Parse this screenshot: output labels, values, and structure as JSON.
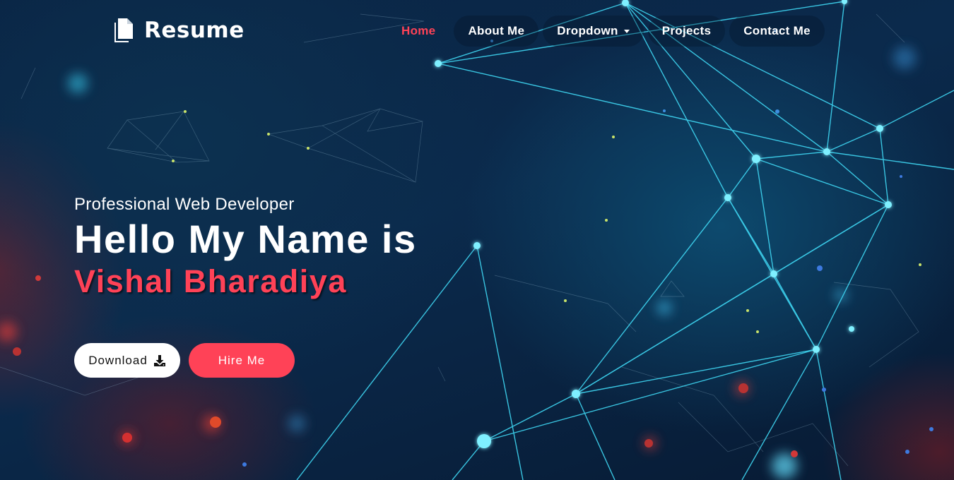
{
  "brand": {
    "name": "Resume",
    "icon": "copy-icon"
  },
  "nav": {
    "items": [
      {
        "label": "Home",
        "active": true
      },
      {
        "label": "About Me",
        "active": false
      },
      {
        "label": "Dropdown",
        "active": false,
        "has_caret": true
      },
      {
        "label": "Projects",
        "active": false
      },
      {
        "label": "Contact Me",
        "active": false
      }
    ]
  },
  "hero": {
    "subtitle": "Professional Web Developer",
    "title": "Hello My Name is",
    "name": "Vishal Bharadiya"
  },
  "actions": {
    "download_label": "Download",
    "download_icon": "download-icon",
    "hire_label": "Hire Me"
  },
  "colors": {
    "accent": "#ff4257",
    "text": "#ffffff",
    "background": "#0a2444",
    "network_line": "#3fd6f2"
  }
}
